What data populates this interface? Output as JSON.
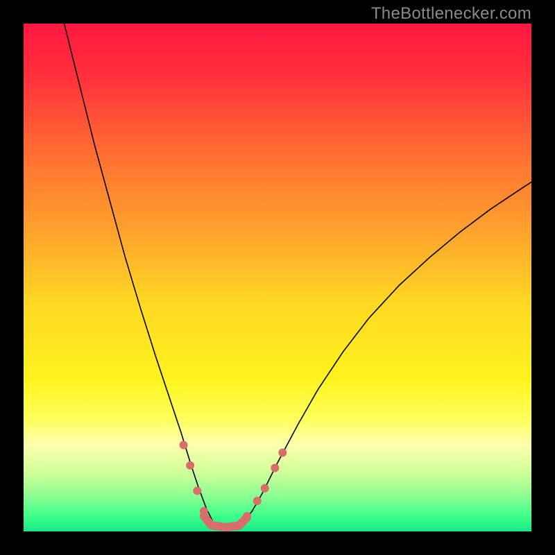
{
  "watermark": "TheBottlenecker.com",
  "chart_data": {
    "type": "line",
    "title": "",
    "xlabel": "",
    "ylabel": "",
    "xlim": [
      0,
      100
    ],
    "ylim": [
      0,
      100
    ],
    "background": {
      "type": "vertical-gradient",
      "stops": [
        {
          "offset": 0.0,
          "color": "#ff183f"
        },
        {
          "offset": 0.1,
          "color": "#ff2f3c"
        },
        {
          "offset": 0.25,
          "color": "#ff6c33"
        },
        {
          "offset": 0.4,
          "color": "#ff9f2e"
        },
        {
          "offset": 0.55,
          "color": "#ffd823"
        },
        {
          "offset": 0.7,
          "color": "#fff31e"
        },
        {
          "offset": 0.78,
          "color": "#ffff5e"
        },
        {
          "offset": 0.83,
          "color": "#fbffae"
        },
        {
          "offset": 0.88,
          "color": "#d4ff9a"
        },
        {
          "offset": 0.93,
          "color": "#8dff92"
        },
        {
          "offset": 0.97,
          "color": "#3eff8a"
        },
        {
          "offset": 1.0,
          "color": "#18e884"
        }
      ]
    },
    "series": [
      {
        "name": "bottleneck-curve",
        "stroke": "#000000",
        "stroke_width": 1.6,
        "points": [
          {
            "x": 8.0,
            "y": 100.0
          },
          {
            "x": 11.0,
            "y": 88.0
          },
          {
            "x": 14.0,
            "y": 76.0
          },
          {
            "x": 17.0,
            "y": 65.0
          },
          {
            "x": 20.0,
            "y": 54.0
          },
          {
            "x": 23.0,
            "y": 44.0
          },
          {
            "x": 26.0,
            "y": 34.5
          },
          {
            "x": 29.0,
            "y": 25.5
          },
          {
            "x": 31.0,
            "y": 19.5
          },
          {
            "x": 33.0,
            "y": 13.0
          },
          {
            "x": 34.5,
            "y": 8.5
          },
          {
            "x": 36.0,
            "y": 4.5
          },
          {
            "x": 37.5,
            "y": 1.5
          },
          {
            "x": 39.0,
            "y": 0.5
          },
          {
            "x": 41.0,
            "y": 0.5
          },
          {
            "x": 43.0,
            "y": 1.5
          },
          {
            "x": 45.0,
            "y": 4.0
          },
          {
            "x": 47.0,
            "y": 7.5
          },
          {
            "x": 50.0,
            "y": 13.5
          },
          {
            "x": 54.0,
            "y": 21.0
          },
          {
            "x": 58.0,
            "y": 28.0
          },
          {
            "x": 63.0,
            "y": 35.5
          },
          {
            "x": 68.0,
            "y": 42.0
          },
          {
            "x": 74.0,
            "y": 48.5
          },
          {
            "x": 80.0,
            "y": 54.0
          },
          {
            "x": 86.0,
            "y": 59.0
          },
          {
            "x": 92.0,
            "y": 63.5
          },
          {
            "x": 98.0,
            "y": 67.5
          },
          {
            "x": 100.0,
            "y": 68.8
          }
        ]
      },
      {
        "name": "data-markers",
        "stroke": "#d86d6a",
        "fill": "#d86d6a",
        "marker_radius": 6,
        "points": [
          {
            "x": 31.5,
            "y": 17.0
          },
          {
            "x": 32.8,
            "y": 13.0
          },
          {
            "x": 34.2,
            "y": 8.0
          },
          {
            "x": 35.5,
            "y": 4.0
          },
          {
            "x": 38.0,
            "y": 1.0
          },
          {
            "x": 40.0,
            "y": 0.8
          },
          {
            "x": 42.0,
            "y": 1.0
          },
          {
            "x": 44.0,
            "y": 3.0
          },
          {
            "x": 46.0,
            "y": 6.0
          },
          {
            "x": 47.5,
            "y": 8.5
          },
          {
            "x": 49.5,
            "y": 12.5
          },
          {
            "x": 51.0,
            "y": 15.5
          }
        ]
      },
      {
        "name": "marker-band",
        "stroke": "#d86d6a",
        "stroke_width": 12,
        "stroke_linecap": "round",
        "points": [
          {
            "x": 35.5,
            "y": 3.0
          },
          {
            "x": 37.0,
            "y": 1.2
          },
          {
            "x": 40.0,
            "y": 0.8
          },
          {
            "x": 42.5,
            "y": 1.2
          },
          {
            "x": 44.0,
            "y": 2.8
          }
        ]
      }
    ]
  }
}
